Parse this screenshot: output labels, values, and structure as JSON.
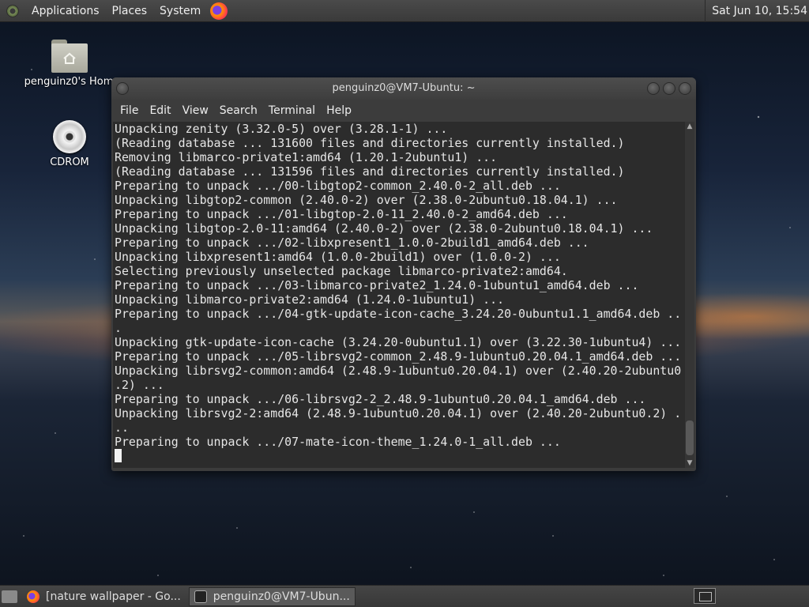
{
  "top_panel": {
    "menus": [
      "Applications",
      "Places",
      "System"
    ],
    "clock": "Sat Jun 10, 15:54"
  },
  "desktop": {
    "icons": [
      {
        "label": "penguinz0's Hom",
        "icon": "home-folder-icon"
      },
      {
        "label": "CDROM",
        "icon": "cdrom-icon"
      }
    ]
  },
  "terminal": {
    "title": "penguinz0@VM7-Ubuntu: ~",
    "menu": [
      "File",
      "Edit",
      "View",
      "Search",
      "Terminal",
      "Help"
    ],
    "lines": [
      "Unpacking zenity (3.32.0-5) over (3.28.1-1) ...",
      "(Reading database ... 131600 files and directories currently installed.)",
      "Removing libmarco-private1:amd64 (1.20.1-2ubuntu1) ...",
      "(Reading database ... 131596 files and directories currently installed.)",
      "Preparing to unpack .../00-libgtop2-common_2.40.0-2_all.deb ...",
      "Unpacking libgtop2-common (2.40.0-2) over (2.38.0-2ubuntu0.18.04.1) ...",
      "Preparing to unpack .../01-libgtop-2.0-11_2.40.0-2_amd64.deb ...",
      "Unpacking libgtop-2.0-11:amd64 (2.40.0-2) over (2.38.0-2ubuntu0.18.04.1) ...",
      "Preparing to unpack .../02-libxpresent1_1.0.0-2build1_amd64.deb ...",
      "Unpacking libxpresent1:amd64 (1.0.0-2build1) over (1.0.0-2) ...",
      "Selecting previously unselected package libmarco-private2:amd64.",
      "Preparing to unpack .../03-libmarco-private2_1.24.0-1ubuntu1_amd64.deb ...",
      "Unpacking libmarco-private2:amd64 (1.24.0-1ubuntu1) ...",
      "Preparing to unpack .../04-gtk-update-icon-cache_3.24.20-0ubuntu1.1_amd64.deb ..",
      ".",
      "Unpacking gtk-update-icon-cache (3.24.20-0ubuntu1.1) over (3.22.30-1ubuntu4) ...",
      "Preparing to unpack .../05-librsvg2-common_2.48.9-1ubuntu0.20.04.1_amd64.deb ...",
      "Unpacking librsvg2-common:amd64 (2.48.9-1ubuntu0.20.04.1) over (2.40.20-2ubuntu0",
      ".2) ...",
      "Preparing to unpack .../06-librsvg2-2_2.48.9-1ubuntu0.20.04.1_amd64.deb ...",
      "Unpacking librsvg2-2:amd64 (2.48.9-1ubuntu0.20.04.1) over (2.40.20-2ubuntu0.2) .",
      "..",
      "Preparing to unpack .../07-mate-icon-theme_1.24.0-1_all.deb ..."
    ]
  },
  "taskbar": {
    "tasks": [
      {
        "label": "[nature wallpaper - Go...",
        "icon": "firefox-icon"
      },
      {
        "label": "penguinz0@VM7-Ubun...",
        "icon": "terminal-icon"
      }
    ]
  }
}
